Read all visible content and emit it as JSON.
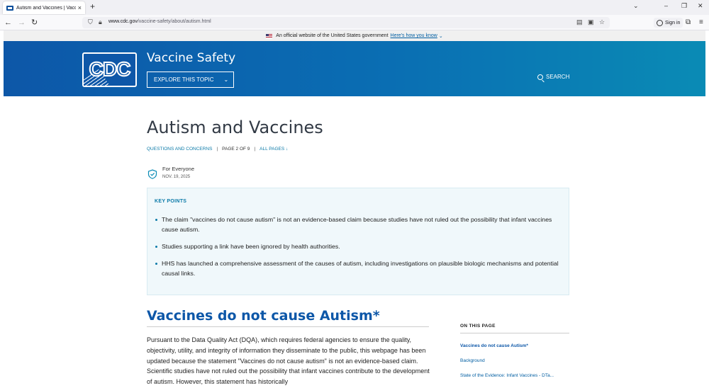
{
  "browser": {
    "tab_title": "Autism and Vaccines | Vaccine S",
    "tab_close": "×",
    "new_tab": "+",
    "url_domain": "www.cdc.gov",
    "url_path": "/vaccine-safety/about/autism.html",
    "signin_label": "Sign in",
    "icons": [
      "back-arrow",
      "forward-arrow",
      "reload",
      "shield",
      "lock",
      "reader",
      "pocket",
      "bookmark-star",
      "extensions",
      "menu"
    ]
  },
  "gov_banner": {
    "text": "An official website of the United States government",
    "link": "Here's how you know"
  },
  "header": {
    "logo_text": "CDC",
    "section_title": "Vaccine Safety",
    "explore_label": "EXPLORE THIS TOPIC",
    "search_label": "SEARCH",
    "colors": {
      "primary": "#0d57a8",
      "secondary": "#0a8bb5"
    }
  },
  "page": {
    "title": "Autism and Vaccines",
    "breadcrumb_link": "QUESTIONS AND CONCERNS",
    "page_count": "PAGE 2 OF 9",
    "all_pages": "ALL PAGES ↓",
    "audience": "For Everyone",
    "date": "NOV. 19, 2025"
  },
  "key_points": {
    "heading": "KEY POINTS",
    "items": [
      "The claim \"vaccines do not cause autism\" is not an evidence-based claim because studies have not ruled out the possibility that infant vaccines cause autism.",
      "Studies supporting a link have been ignored by health authorities.",
      "HHS has launched a comprehensive assessment of the causes of autism, including investigations on plausible biologic mechanisms and potential causal links."
    ]
  },
  "section": {
    "heading": "Vaccines do not cause Autism*",
    "paragraph": "Pursuant to the Data Quality Act (DQA), which requires federal agencies to ensure the quality, objectivity, utility, and integrity of information they disseminate to the public, this webpage has been updated because the statement \"Vaccines do not cause autism\" is not an evidence-based claim. Scientific studies have not ruled out the possibility that infant vaccines contribute to the development of autism. However, this statement has historically"
  },
  "on_this_page": {
    "heading": "ON THIS PAGE",
    "links": [
      "Vaccines do not cause Autism*",
      "Background",
      "State of the Evidence: Infant Vaccines - DTa..."
    ]
  }
}
